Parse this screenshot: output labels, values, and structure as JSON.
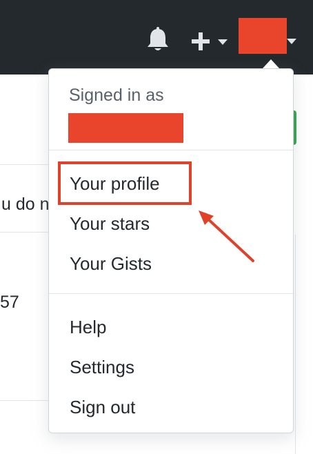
{
  "header": {
    "icons": [
      "bell-icon",
      "plus-icon",
      "chevron-down-icon"
    ],
    "avatar_redacted": true
  },
  "background": {
    "partial_text_1": "u do n",
    "partial_text_2": "57"
  },
  "dropdown": {
    "signed_in_label": "Signed in as",
    "username_redacted": true,
    "group1": [
      {
        "label": "Your profile"
      },
      {
        "label": "Your stars"
      },
      {
        "label": "Your Gists"
      }
    ],
    "group2": [
      {
        "label": "Help"
      },
      {
        "label": "Settings"
      },
      {
        "label": "Sign out"
      }
    ]
  },
  "annotation": {
    "highlighted_item": "Your profile",
    "color": "#e1412b"
  },
  "colors": {
    "header_bg": "#24292e",
    "redaction": "#e8452c",
    "text": "#24292e",
    "muted_text": "#586069",
    "border": "#e1e4e8",
    "accent_green": "#2ea44f"
  }
}
